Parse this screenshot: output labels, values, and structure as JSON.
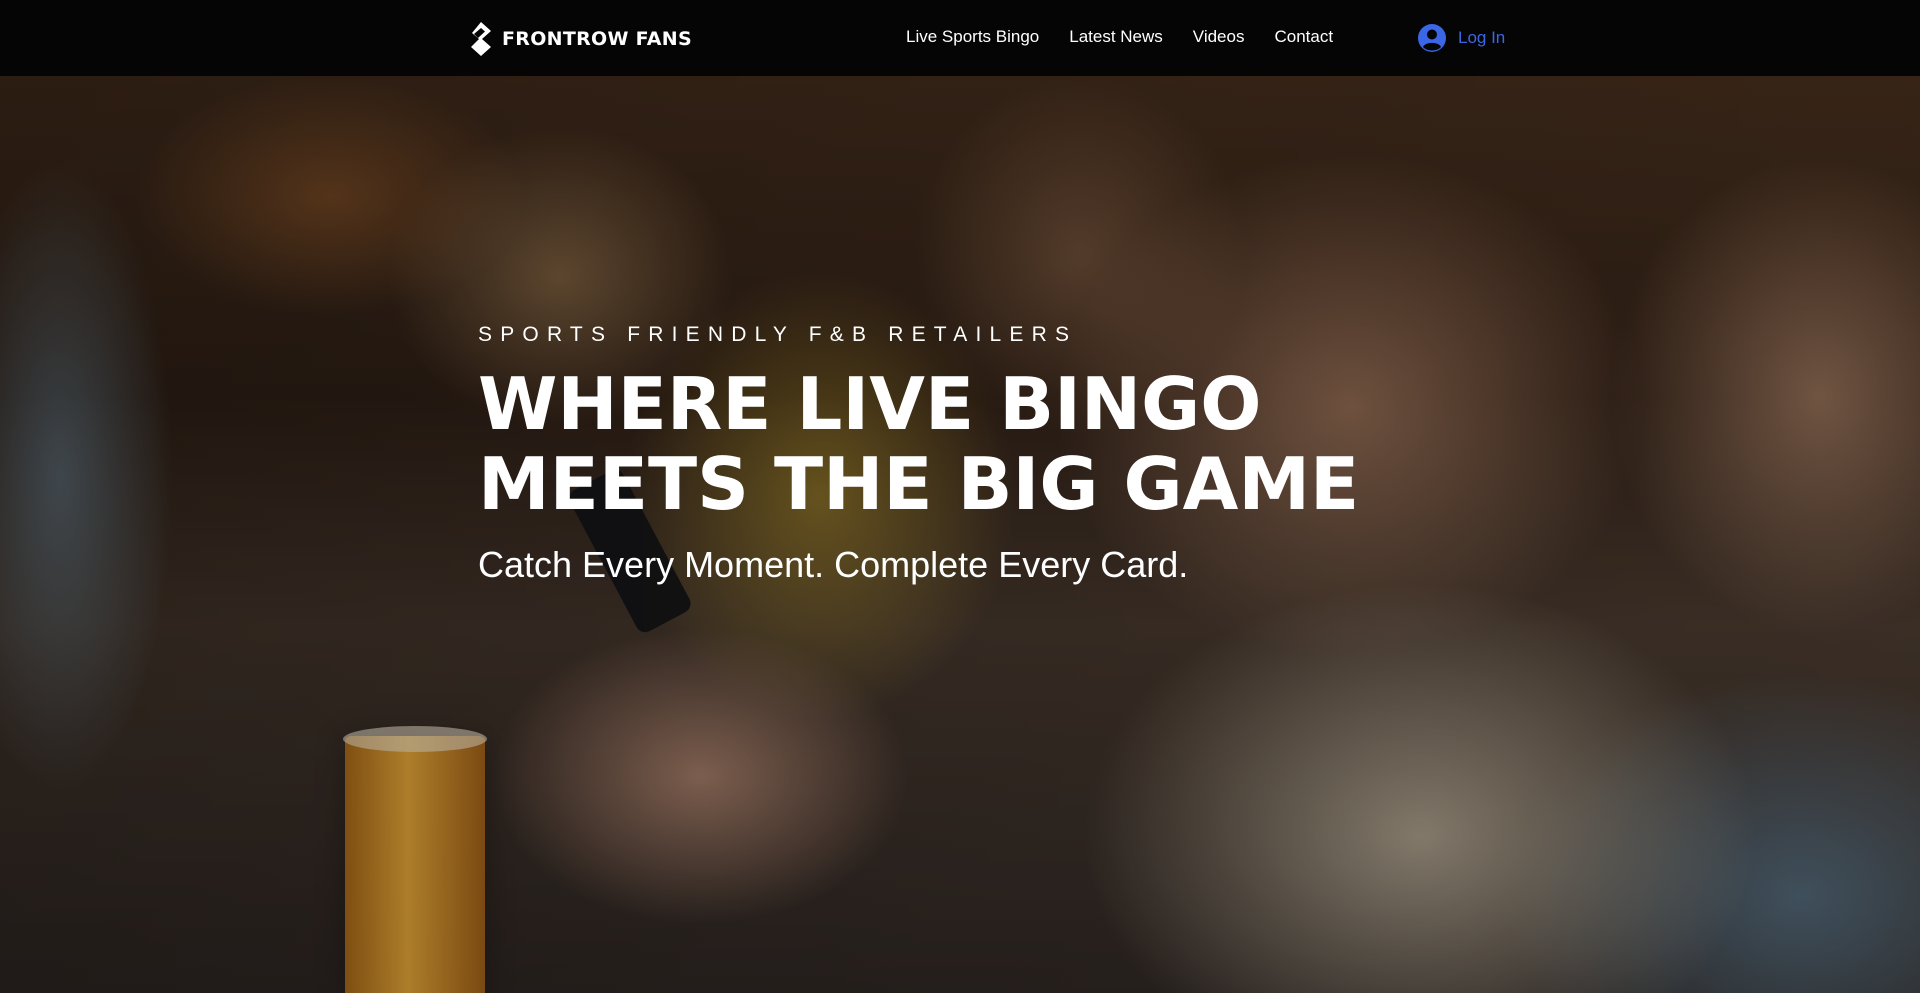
{
  "header": {
    "brand": "FRONTROW FANS",
    "nav": [
      {
        "label": "Live Sports Bingo"
      },
      {
        "label": "Latest News"
      },
      {
        "label": "Videos"
      },
      {
        "label": "Contact"
      }
    ],
    "login_label": "Log In",
    "login_icon": "user-avatar-icon",
    "logo_icon": "frontrow-logo-icon"
  },
  "hero": {
    "eyebrow": "SPORTS FRIENDLY F&B RETAILERS",
    "headline_line1": "WHERE LIVE BINGO",
    "headline_line2": "MEETS THE BIG GAME",
    "tagline": "Catch Every Moment. Complete Every Card."
  },
  "colors": {
    "header_bg": "#050505",
    "login_accent": "#3b67e6",
    "text": "#ffffff"
  }
}
